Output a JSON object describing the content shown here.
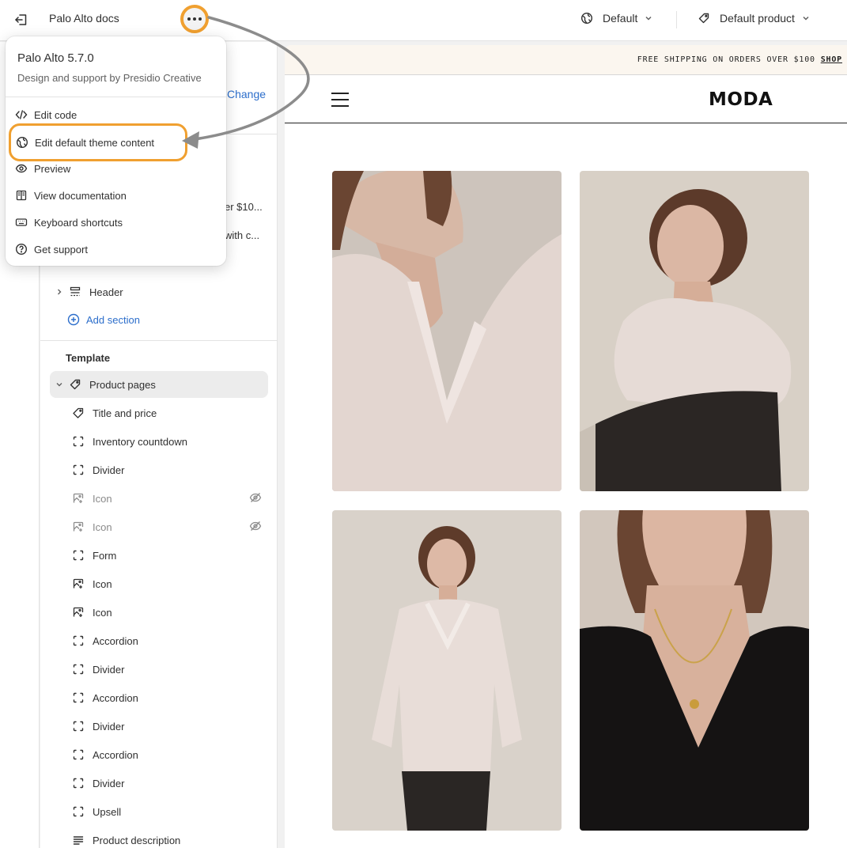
{
  "topbar": {
    "store_title": "Palo Alto docs",
    "theme_select": "Default",
    "product_select": "Default product"
  },
  "menu": {
    "app_name": "Palo Alto",
    "version": "5.7.0",
    "subtitle": "Design and support by Presidio Creative",
    "items": [
      {
        "label": "Edit code",
        "icon": "code-icon"
      },
      {
        "label": "Edit default theme content",
        "icon": "globe-icon"
      },
      {
        "label": "Preview",
        "icon": "eye-icon"
      },
      {
        "label": "View documentation",
        "icon": "book-icon"
      },
      {
        "label": "Keyboard shortcuts",
        "icon": "keyboard-icon"
      },
      {
        "label": "Get support",
        "icon": "question-icon"
      }
    ]
  },
  "sidebar": {
    "change_link": "Change",
    "peek_1": "er $10...",
    "peek_2": "with c...",
    "header_item": "Header",
    "add_section": "Add section",
    "template_label": "Template",
    "product_pages": "Product pages",
    "blocks": [
      {
        "label": "Title and price",
        "icon": "title-icon",
        "hidden": false
      },
      {
        "label": "Inventory countdown",
        "icon": "block-icon",
        "hidden": false
      },
      {
        "label": "Divider",
        "icon": "block-icon",
        "hidden": false
      },
      {
        "label": "Icon",
        "icon": "image-icon",
        "hidden": true
      },
      {
        "label": "Icon",
        "icon": "image-icon",
        "hidden": true
      },
      {
        "label": "Form",
        "icon": "block-icon",
        "hidden": false
      },
      {
        "label": "Icon",
        "icon": "image-icon",
        "hidden": false
      },
      {
        "label": "Icon",
        "icon": "image-icon",
        "hidden": false
      },
      {
        "label": "Accordion",
        "icon": "block-icon",
        "hidden": false
      },
      {
        "label": "Divider",
        "icon": "block-icon",
        "hidden": false
      },
      {
        "label": "Accordion",
        "icon": "block-icon",
        "hidden": false
      },
      {
        "label": "Divider",
        "icon": "block-icon",
        "hidden": false
      },
      {
        "label": "Accordion",
        "icon": "block-icon",
        "hidden": false
      },
      {
        "label": "Divider",
        "icon": "block-icon",
        "hidden": false
      },
      {
        "label": "Upsell",
        "icon": "block-icon",
        "hidden": false
      },
      {
        "label": "Product description",
        "icon": "text-icon",
        "hidden": false
      }
    ]
  },
  "preview": {
    "announcement": "FREE SHIPPING ON ORDERS OVER $100",
    "announcement_link": "SHOP",
    "brand": "MODA"
  },
  "colors": {
    "highlight": "#f0a030",
    "link": "#2c6ecb",
    "arrow": "#8c8c8c"
  }
}
